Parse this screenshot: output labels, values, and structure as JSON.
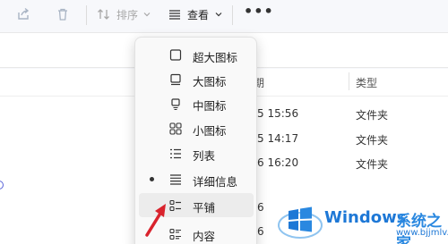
{
  "toolbar": {
    "share_icon": "share-icon",
    "delete_icon": "trash-icon",
    "sort_label": "排序",
    "view_label": "查看",
    "more_label": "•••"
  },
  "columns": {
    "date_label": "期",
    "type_label": "类型"
  },
  "rows": [
    {
      "date": "/5 15:56",
      "type": "文件夹"
    },
    {
      "date": "/5 14:17",
      "type": "文件夹"
    },
    {
      "date": "/6 16:20",
      "type": "文件夹"
    },
    {
      "date": "/6"
    },
    {
      "date": "/6"
    }
  ],
  "menu": {
    "items": [
      {
        "label": "超大图标",
        "icon": "extra-large-icons-icon"
      },
      {
        "label": "大图标",
        "icon": "large-icons-icon"
      },
      {
        "label": "中图标",
        "icon": "medium-icons-icon"
      },
      {
        "label": "小图标",
        "icon": "small-icons-icon"
      },
      {
        "label": "列表",
        "icon": "list-icon"
      },
      {
        "label": "详细信息",
        "icon": "details-icon",
        "selected": true
      },
      {
        "label": "平铺",
        "icon": "tiles-icon",
        "hovered": true
      },
      {
        "label": "内容",
        "icon": "content-icon"
      }
    ]
  },
  "watermark": {
    "title": "Windows",
    "subtitle": "系统之家",
    "url": "www.bjjmlv.com"
  },
  "colors": {
    "accent": "#1e78d6",
    "arrow": "#d9232d",
    "menu_bg": "#f9f9f9"
  }
}
